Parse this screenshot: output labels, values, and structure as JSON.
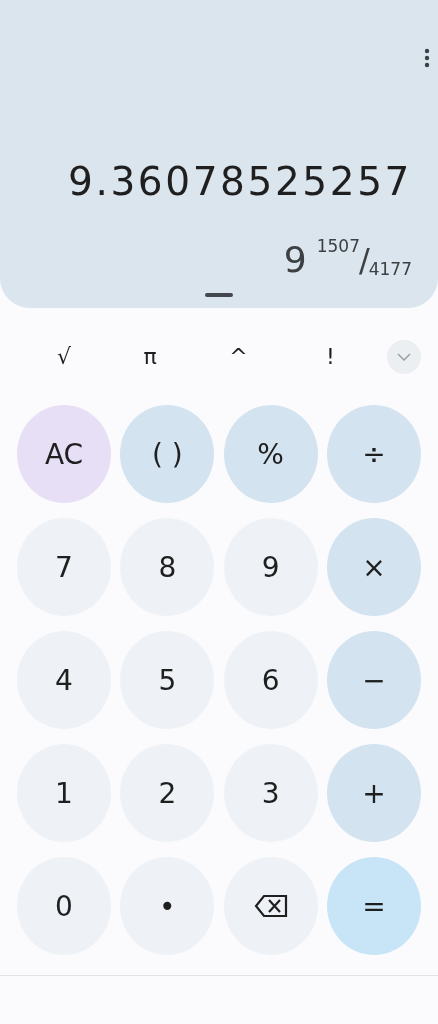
{
  "display": {
    "result": "9.36078525257",
    "fraction": {
      "whole": "9",
      "numerator": "1507",
      "separator": "/",
      "denominator": "4177"
    }
  },
  "functions": [
    "√",
    "π",
    "^",
    "!"
  ],
  "keys": [
    {
      "label": "AC",
      "kind": "clear"
    },
    {
      "label": "( )",
      "kind": "operator"
    },
    {
      "label": "%",
      "kind": "operator"
    },
    {
      "label": "÷",
      "kind": "operator"
    },
    {
      "label": "7",
      "kind": "digit"
    },
    {
      "label": "8",
      "kind": "digit"
    },
    {
      "label": "9",
      "kind": "digit"
    },
    {
      "label": "×",
      "kind": "operator"
    },
    {
      "label": "4",
      "kind": "digit"
    },
    {
      "label": "5",
      "kind": "digit"
    },
    {
      "label": "6",
      "kind": "digit"
    },
    {
      "label": "−",
      "kind": "operator"
    },
    {
      "label": "1",
      "kind": "digit"
    },
    {
      "label": "2",
      "kind": "digit"
    },
    {
      "label": "3",
      "kind": "digit"
    },
    {
      "label": "+",
      "kind": "operator"
    },
    {
      "label": "0",
      "kind": "digit"
    },
    {
      "label": "•",
      "kind": "digit"
    },
    {
      "kind": "backspace"
    },
    {
      "label": "=",
      "kind": "equals"
    }
  ]
}
